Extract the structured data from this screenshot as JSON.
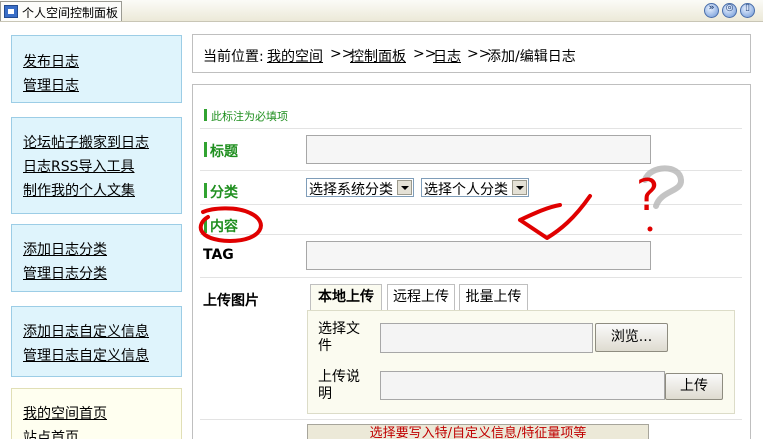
{
  "window": {
    "title": "个人空间控制面板"
  },
  "window_buttons": [
    "»",
    "◎",
    "▯",
    "▪"
  ],
  "sidebar": {
    "groups": [
      [
        "发布日志",
        "管理日志"
      ],
      [
        "论坛帖子搬家到日志",
        "日志RSS导入工具",
        "制作我的个人文集"
      ],
      [
        "添加日志分类",
        "管理日志分类"
      ],
      [
        "添加日志自定义信息",
        "管理日志自定义信息"
      ],
      [
        "我的空间首页",
        "站点首页"
      ]
    ]
  },
  "breadcrumb": {
    "prefix": "当前位置:",
    "items": [
      "我的空间",
      "控制面板",
      "日志"
    ],
    "sep": ">>",
    "current": "添加/编辑日志"
  },
  "form": {
    "required_note": "此标注为必填项",
    "title_label": "标题",
    "category_label": "分类",
    "content_label": "内容",
    "tag_label": "TAG",
    "upload_label": "上传图片",
    "system_category": "选择系统分类",
    "personal_category": "选择个人分类",
    "tabs": [
      "本地上传",
      "远程上传",
      "批量上传"
    ],
    "choose_file_label": "选择文件",
    "browse_button": "浏览...",
    "upload_desc_label": "上传说明",
    "upload_button": "上传",
    "bottom_button": "选择要写入特/自定义信息/特征量项等"
  },
  "annotation": {
    "question_mark": "?"
  },
  "colors": {
    "required": "#1f8f1f",
    "annotation": "#e00000",
    "sidebar_bg": "#dff4fc"
  }
}
